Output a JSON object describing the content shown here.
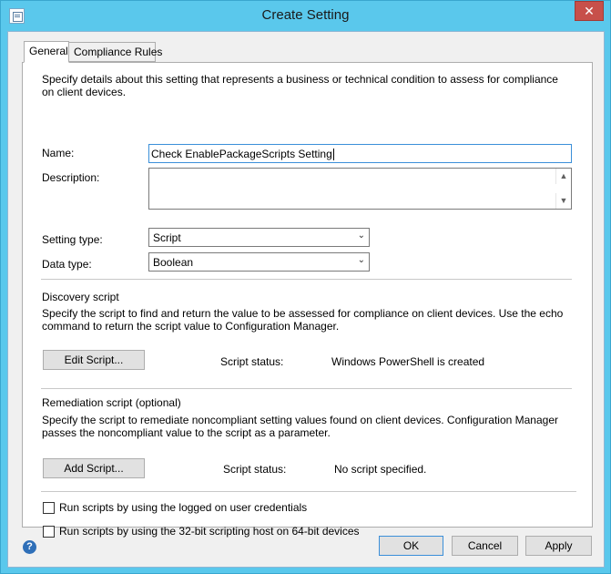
{
  "window": {
    "title": "Create Setting",
    "close_glyph": "✕"
  },
  "tabs": [
    {
      "label": "General",
      "active": true
    },
    {
      "label": "Compliance Rules",
      "active": false
    }
  ],
  "general": {
    "intro": "Specify details about this setting that represents a business or technical condition to assess for compliance on client devices.",
    "name_label": "Name:",
    "name_value": "Check EnablePackageScripts Setting",
    "description_label": "Description:",
    "description_value": "",
    "setting_type_label": "Setting type:",
    "setting_type_value": "Script",
    "data_type_label": "Data type:",
    "data_type_value": "Boolean"
  },
  "discovery": {
    "heading": "Discovery script",
    "text": "Specify the script to find and return the value to be assessed for compliance on client devices. Use the echo command to return the script value to Configuration Manager.",
    "button_label": "Edit Script...",
    "status_label": "Script status:",
    "status_value": "Windows PowerShell is created"
  },
  "remediation": {
    "heading": "Remediation script (optional)",
    "text": "Specify the script to remediate noncompliant setting values found on client devices. Configuration Manager passes the noncompliant value to the script as a parameter.",
    "button_label": "Add Script...",
    "status_label": "Script status:",
    "status_value": "No script specified."
  },
  "options": {
    "logged_on_label": "Run scripts by using the logged on user credentials",
    "logged_on_checked": false,
    "host32_label": "Run scripts by using the 32-bit scripting host on 64-bit devices",
    "host32_checked": false
  },
  "footer": {
    "help_glyph": "?",
    "ok_label": "OK",
    "cancel_label": "Cancel",
    "apply_label": "Apply"
  },
  "icons": {
    "app": "document-icon",
    "dropdown": "chevron-down-icon",
    "help": "help-icon",
    "scroll_up": "scroll-up-icon",
    "scroll_down": "scroll-down-icon"
  },
  "colors": {
    "titlebar": "#5ac8ec",
    "close": "#c7504a",
    "focus": "#3b8fd9"
  }
}
